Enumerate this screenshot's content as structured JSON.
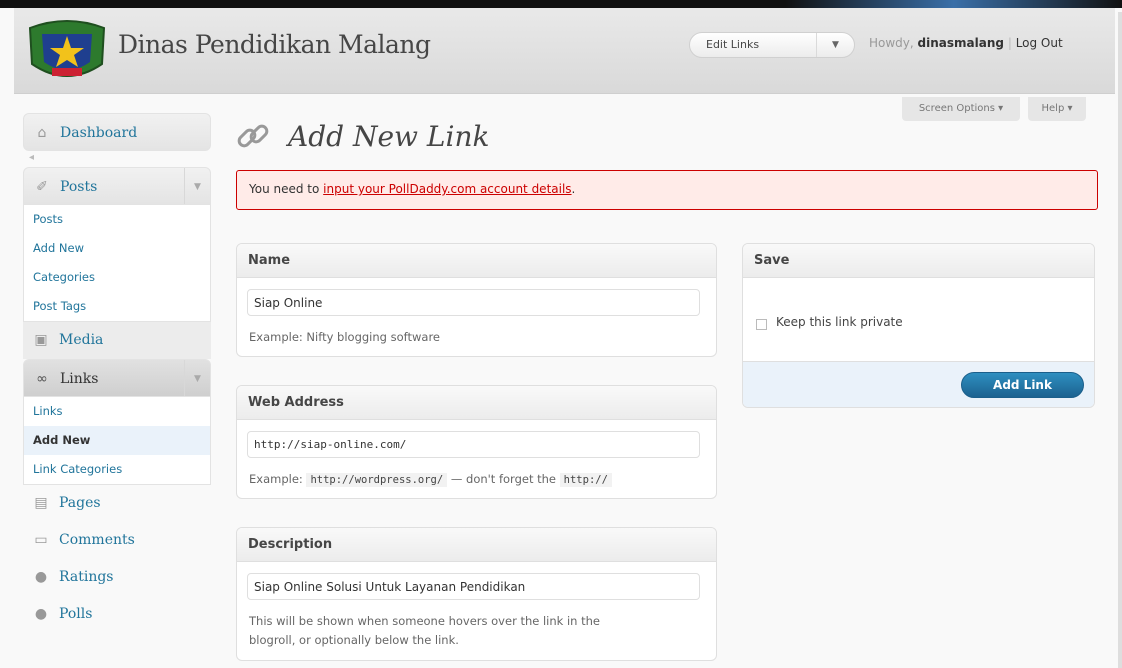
{
  "header": {
    "site_title": "Dinas Pendidikan Malang",
    "favorite_actions": "Edit Links",
    "howdy_prefix": "Howdy,",
    "username": "dinasmalang",
    "separator": "|",
    "logout": "Log Out"
  },
  "screen_tabs": {
    "screen_options": "Screen Options ▾",
    "help": "Help ▾"
  },
  "sidebar": {
    "dashboard": "Dashboard",
    "posts": {
      "label": "Posts",
      "submenu": [
        "Posts",
        "Add New",
        "Categories",
        "Post Tags"
      ]
    },
    "media": "Media",
    "links": {
      "label": "Links",
      "submenu": [
        "Links",
        "Add New",
        "Link Categories"
      ],
      "current_index": 1
    },
    "pages": "Pages",
    "comments": "Comments",
    "ratings": "Ratings",
    "polls": "Polls"
  },
  "main": {
    "title": "Add New Link",
    "notice": {
      "prefix": "You need to ",
      "link_text": "input your PollDaddy.com account details",
      "suffix": "."
    },
    "name_box": {
      "heading": "Name",
      "value": "Siap Online",
      "hint": "Example: Nifty blogging software"
    },
    "address_box": {
      "heading": "Web Address",
      "value": "http://siap-online.com/",
      "hint_prefix": "Example:",
      "hint_code1": "http://wordpress.org/",
      "hint_middle": "— don't forget the",
      "hint_code2": "http://"
    },
    "description_box": {
      "heading": "Description",
      "value": "Siap Online Solusi Untuk Layanan Pendidikan",
      "hint_line1": "This will be shown when someone hovers over the link in the",
      "hint_line2": "blogroll, or optionally below the link."
    },
    "save_box": {
      "heading": "Save",
      "private_label": "Keep this link private",
      "private_checked": false,
      "button": "Add Link"
    }
  },
  "colors": {
    "link": "#21759b",
    "error_border": "#cc0000",
    "error_bg": "#ffebe8",
    "primary_button": "#21759b"
  }
}
